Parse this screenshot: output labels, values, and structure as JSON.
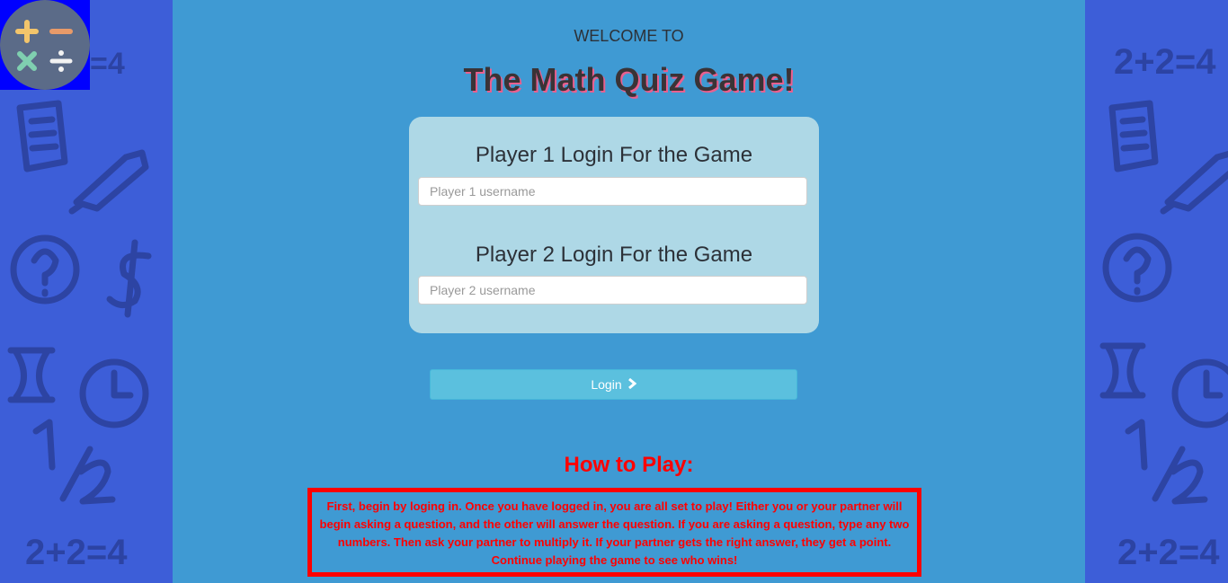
{
  "header": {
    "welcome": "WELCOME TO",
    "title": "The Math Quiz Game!"
  },
  "login": {
    "player1": {
      "heading": "Player 1 Login For the Game",
      "placeholder": "Player 1 username",
      "value": ""
    },
    "player2": {
      "heading": "Player 2 Login For the Game",
      "placeholder": "Player 2 username",
      "value": ""
    },
    "button_label": "Login",
    "button_icon": "chevron-right-icon"
  },
  "how_to_play": {
    "heading": "How to Play:",
    "text": "First, begin by loging in. Once you have logged in, you are all set to play! Either you or your partner will begin asking a question, and the other will answer the question. If you are asking a question, type any two numbers. Then ask your partner to multiply it. If your partner gets the right answer, they get a point. Continue playing the game to see who wins!"
  },
  "colors": {
    "side_background": "#3d5ed8",
    "main_background": "#3f9ad3",
    "card_background": "#aed8e6",
    "button": "#5bc0de",
    "instructions_red": "#ff0000"
  },
  "icons": {
    "logo": "math-operators-logo-icon"
  }
}
